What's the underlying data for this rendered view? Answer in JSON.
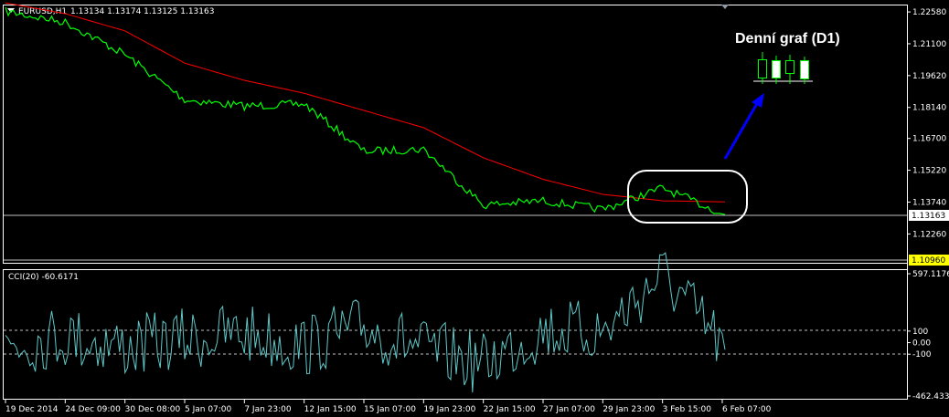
{
  "header": {
    "symbol_text": "EURUSD,H1",
    "ohlc_text": "1.13134 1.13174 1.13125 1.13163"
  },
  "annotation": {
    "title": "Denní graf (D1)"
  },
  "colors": {
    "background": "#000000",
    "price_line": "#00ff00",
    "moving_average": "#ff0000",
    "cci_line": "#5fc8c8",
    "grid": "#c0c0c0",
    "frame": "#ffffff",
    "arrow": "#0000ff",
    "current_price_label_bg": "#ffffff",
    "low_price_label_bg": "#ffff00"
  },
  "chart_data": [
    {
      "type": "line",
      "title": "EURUSD,H1",
      "price_axis_ticks": [
        "1.22580",
        "1.21100",
        "1.19620",
        "1.18140",
        "1.16700",
        "1.15220",
        "1.13740",
        "1.12260"
      ],
      "current_price_label": "1.13163",
      "low_price_label": "1.10960",
      "ylim": [
        1.1096,
        1.2288
      ],
      "x_tick_labels": [
        "19 Dec 2014",
        "24 Dec 09:00",
        "30 Dec 08:00",
        "5 Jan 07:00",
        "7 Jan 23:00",
        "12 Jan 15:00",
        "15 Jan 07:00",
        "19 Jan 23:00",
        "22 Jan 15:00",
        "27 Jan 07:00",
        "29 Jan 23:00",
        "3 Feb 15:00",
        "6 Feb 07:00"
      ],
      "series": [
        {
          "name": "",
          "x": [
            "19 Dec 2014",
            "24 Dec 09:00",
            "30 Dec 08:00",
            "5 Jan 07:00",
            "7 Jan 23:00",
            "12 Jan 15:00",
            "15 Jan 07:00",
            "19 Jan 23:00",
            "22 Jan 15:00",
            "27 Jan 07:00",
            "29 Jan 23:00",
            "3 Feb 15:00",
            "6 Feb 07:00"
          ],
          "values": [
            1.226,
            1.221,
            1.206,
            1.185,
            1.182,
            1.183,
            1.161,
            1.162,
            1.136,
            1.138,
            1.134,
            1.144,
            1.1316
          ]
        },
        {
          "name": "",
          "x": [
            "19 Dec 2014",
            "24 Dec 09:00",
            "30 Dec 08:00",
            "5 Jan 07:00",
            "7 Jan 23:00",
            "12 Jan 15:00",
            "15 Jan 07:00",
            "19 Jan 23:00",
            "22 Jan 15:00",
            "27 Jan 07:00",
            "29 Jan 23:00",
            "3 Feb 15:00",
            "6 Feb 07:00"
          ],
          "values": [
            1.23,
            1.225,
            1.217,
            1.202,
            1.194,
            1.188,
            1.18,
            1.172,
            1.158,
            1.148,
            1.141,
            1.138,
            1.1375
          ]
        }
      ]
    },
    {
      "type": "line",
      "title": "CCI(20) -60.6171",
      "axis_ticks": [
        "597.1176",
        "100",
        "0.00",
        "-100",
        "-462.4339"
      ],
      "ylim": [
        -462.4339,
        597.1176
      ],
      "reference_levels": [
        100,
        -100
      ],
      "series": [
        {
          "name": "",
          "x": [
            "19 Dec 2014",
            "24 Dec 09:00",
            "30 Dec 08:00",
            "5 Jan 07:00",
            "7 Jan 23:00",
            "12 Jan 15:00",
            "15 Jan 07:00",
            "19 Jan 23:00",
            "22 Jan 15:00",
            "27 Jan 07:00",
            "29 Jan 23:00",
            "3 Feb 15:00",
            "6 Feb 07:00"
          ],
          "values": [
            -20,
            60,
            -40,
            30,
            80,
            -30,
            140,
            -60,
            -180,
            110,
            90,
            597,
            -60.6171
          ]
        }
      ]
    }
  ]
}
